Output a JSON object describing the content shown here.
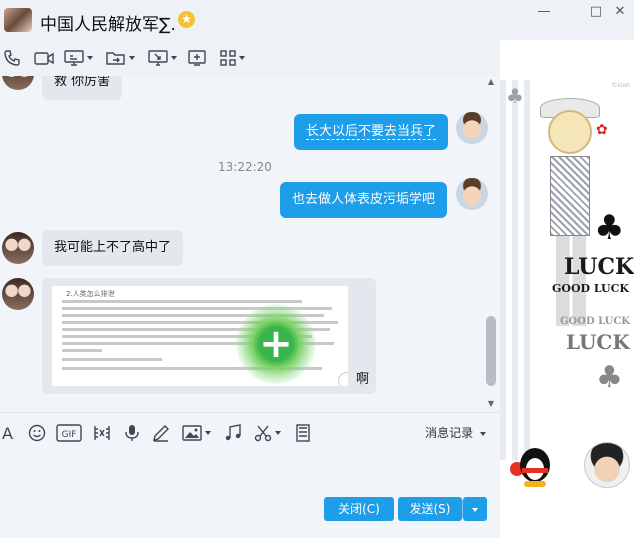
{
  "title_bar": {
    "name": "中国人民解放军∑.",
    "badge_icon": "vip-star-icon",
    "buttons": [
      "minimize",
      "maximize",
      "close"
    ],
    "minimize_glyph": "—",
    "maximize_glyph": "□",
    "close_glyph": "✕"
  },
  "toolbar": {
    "icons": [
      "phone-icon",
      "video-call-icon",
      "screen-share-icon",
      "transfer-file-icon",
      "remote-desktop-icon",
      "add-icon",
      "apps-grid-icon"
    ],
    "accent_color": "#1e9ee8"
  },
  "chat": {
    "messages": [
      {
        "side": "left",
        "text": "救 你厉害"
      },
      {
        "side": "right",
        "text": "长大以后不要去当兵了"
      },
      {
        "side": "right",
        "text": "也去做人体表皮污垢学吧"
      },
      {
        "side": "left",
        "text": "我可能上不了高中了"
      }
    ],
    "timestamp": "13:22:20",
    "image_message": {
      "doc_header": "2.人类怎么排泄",
      "caption": "啊"
    }
  },
  "input_toolbar": {
    "icons": [
      "font-icon",
      "emoji-icon",
      "gif-icon",
      "scissors-screenshot-icon",
      "microphone-icon",
      "pen-icon",
      "image-icon",
      "music-icon",
      "cut-icon",
      "doc-icon"
    ],
    "gif_label": "GIF",
    "history_label": "消息记录"
  },
  "actions": {
    "close_label": "关闭(C)",
    "send_label": "发送(S)"
  },
  "side_panel": {
    "luck_text_1": "LUCK",
    "good_luck_1": "GOOD LUCK",
    "good_luck_2": "GOOD LUCK",
    "luck_text_2": "LUCK",
    "watermark": "©icon"
  }
}
